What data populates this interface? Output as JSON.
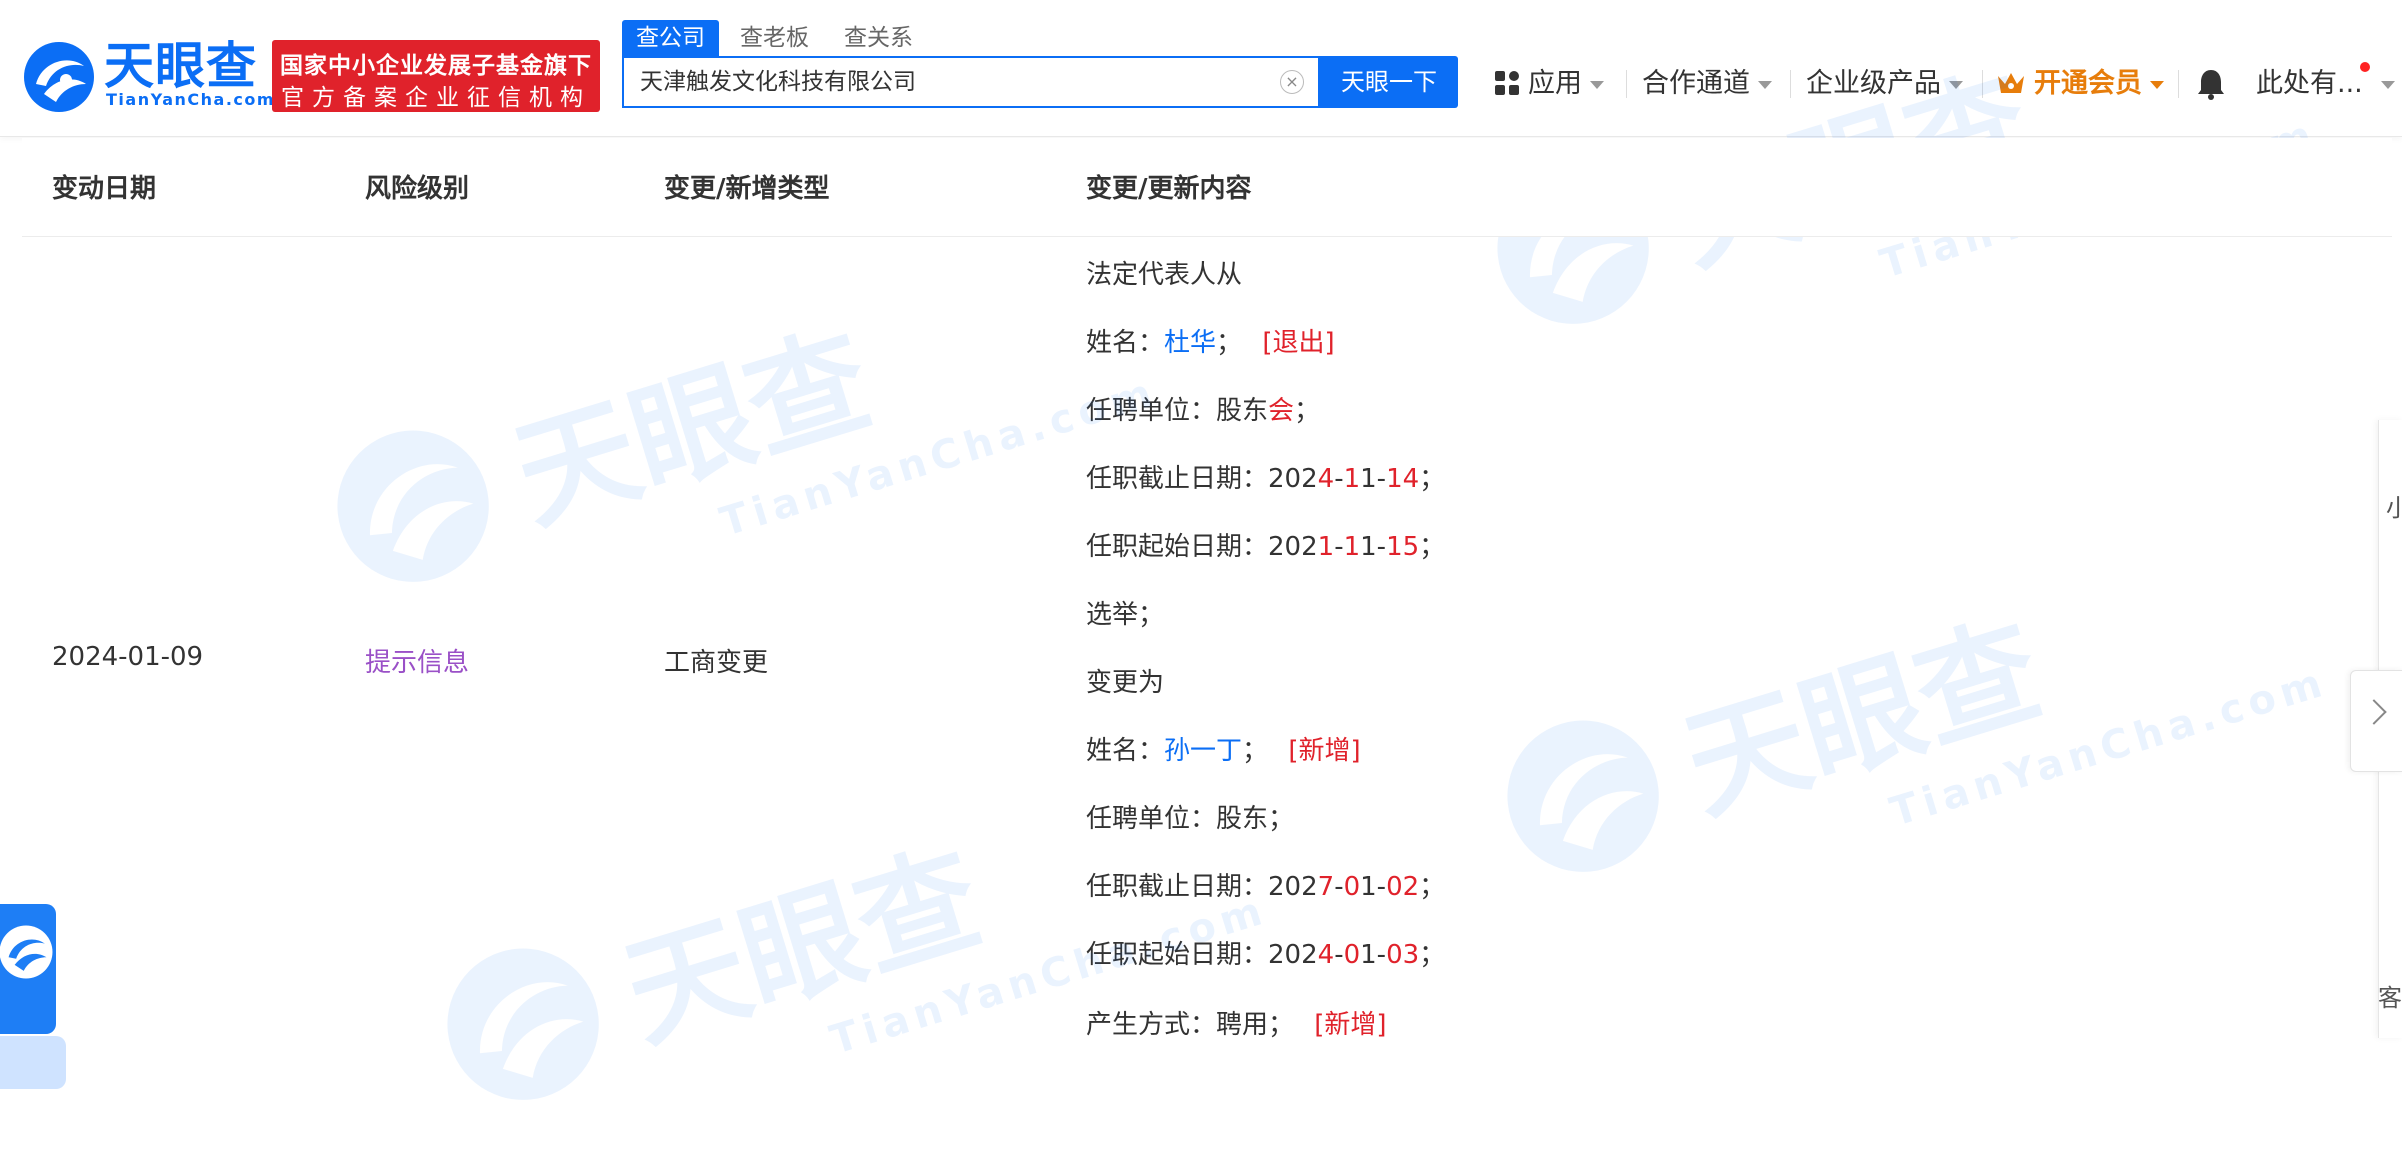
{
  "header": {
    "logo_text": "天眼查",
    "logo_sub": "TianYanCha.com",
    "badge_line1": "国家中小企业发展子基金旗下",
    "badge_line2": "官方备案企业征信机构",
    "tabs": [
      {
        "label": "查公司",
        "active": true
      },
      {
        "label": "查老板",
        "active": false
      },
      {
        "label": "查关系",
        "active": false
      }
    ],
    "search": {
      "value": "天津触发文化科技有限公司",
      "button_label": "天眼一下"
    },
    "nav": [
      {
        "label": "应用"
      },
      {
        "label": "合作通道"
      },
      {
        "label": "企业级产品"
      },
      {
        "label": "开通会员",
        "highlight": true
      },
      {
        "label": "此处有..."
      }
    ],
    "accent_color": "#0b6ef5",
    "vip_color": "#e77d0b"
  },
  "table": {
    "headers": [
      "变动日期",
      "风险级别",
      "变更/新增类型",
      "变更/更新内容"
    ],
    "row": {
      "date": "2024-01-09",
      "risk": "提示信息",
      "type": "工商变更",
      "content": {
        "before_title": "法定代表人从",
        "before_name_label": "姓名：",
        "before_name": "杜华",
        "before_name_sep": "；",
        "before_tag": "[退出]",
        "before_unit_label": "任聘单位：",
        "before_unit_plain": "股东",
        "before_unit_red": "会",
        "before_unit_end": "；",
        "before_end_label": "任职截止日期：",
        "before_end_date": "2024-11-14",
        "before_start_label": "任职起始日期：",
        "before_start_date": "2021-11-15",
        "before_method": "选举；",
        "after_title": "变更为",
        "after_name_label": "姓名：",
        "after_name": "孙一丁",
        "after_name_sep": "；",
        "after_tag": "[新增]",
        "after_unit": "任聘单位：股东；",
        "after_end_label": "任职截止日期：",
        "after_end_date": "2027-01-02",
        "after_start_label": "任职起始日期：",
        "after_start_date": "2024-01-03",
        "after_method_label": "产生方式：聘用；",
        "after_method_tag": "[新增]"
      }
    },
    "risk_color": "#9a50c7",
    "tag_color": "#e0222b"
  },
  "side": {
    "right_char1": "小",
    "right_char2": "客"
  },
  "watermark": {
    "text": "天眼查",
    "sub": "TianYanCha.com"
  }
}
